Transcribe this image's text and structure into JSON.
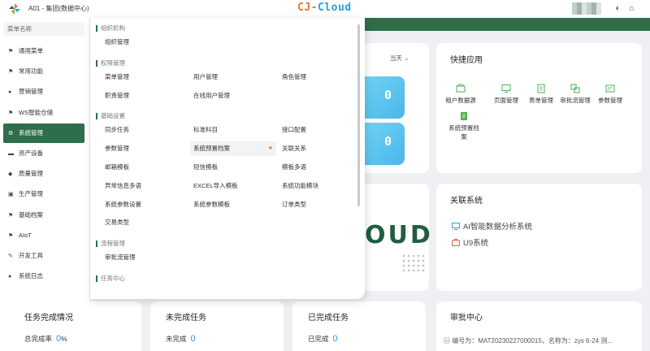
{
  "header": {
    "org": "A01 - 集团(数据中心)",
    "brand_part1": "CJ-",
    "brand_part2": "Cloud"
  },
  "sidebar": {
    "search_placeholder": "菜单名称",
    "items": [
      {
        "label": "通用菜单",
        "icon": "flag-icon",
        "glyph": "⚑"
      },
      {
        "label": "常用功能",
        "icon": "flag-icon",
        "glyph": "⚑"
      },
      {
        "label": "营销管理",
        "icon": "user-icon",
        "glyph": "●"
      },
      {
        "label": "WS智能仓储",
        "icon": "flag-icon",
        "glyph": "⚑"
      },
      {
        "label": "系统管理",
        "icon": "gear-icon",
        "glyph": "⚙",
        "active": true
      },
      {
        "label": "资产设备",
        "icon": "car-icon",
        "glyph": "▬"
      },
      {
        "label": "质量管理",
        "icon": "shield-icon",
        "glyph": "◆"
      },
      {
        "label": "生产管理",
        "icon": "cart-icon",
        "glyph": "▣"
      },
      {
        "label": "基础档案",
        "icon": "flag-icon",
        "glyph": "⚑"
      },
      {
        "label": "AIoT",
        "icon": "flag-icon",
        "glyph": "⚑"
      },
      {
        "label": "开发工具",
        "icon": "wrench-icon",
        "glyph": "✎"
      },
      {
        "label": "系统日志",
        "icon": "info-icon",
        "glyph": "●"
      }
    ]
  },
  "menu_panel": {
    "sections": [
      {
        "title": "组织机构",
        "items": [
          "组织管理"
        ]
      },
      {
        "title": "权限管理",
        "items": [
          "菜单管理",
          "用户管理",
          "角色管理",
          "职责管理",
          "在线用户管理"
        ]
      },
      {
        "title": "基础设置",
        "items": [
          "同步任务",
          "标准科目",
          "接口配置",
          "参数管理",
          "系统预置档案",
          "关联关系",
          "邮箱模板",
          "短信模板",
          "模板多语",
          "异常信息多语",
          "EXCEL导入模板",
          "系统功能模块",
          "系统参数设置",
          "系统参数模板",
          "订单类型",
          "交易类型"
        ]
      },
      {
        "title": "流程管理",
        "items": [
          "审批流管理"
        ]
      },
      {
        "title": "任务中心",
        "items": []
      }
    ],
    "highlighted": "系统预置档案",
    "star": "★"
  },
  "overview": {
    "period": "当天",
    "counter1": "0",
    "counter2": "0",
    "banner_text": "OUD"
  },
  "quick_apps": {
    "title": "快捷应用",
    "items": [
      "租户数据源",
      "页面管理",
      "表单管理",
      "审批流管理",
      "参数管理",
      "系统预置档案"
    ]
  },
  "related_systems": {
    "title": "关联系统",
    "items": [
      "AI智能数据分析系统",
      "U9系统"
    ]
  },
  "stats": {
    "task_completion": {
      "title": "任务完成情况",
      "label": "总完成率",
      "value": "0",
      "suffix": "%"
    },
    "unfinished": {
      "title": "未完成任务",
      "label": "未完成",
      "value": "0"
    },
    "finished": {
      "title": "已完成任务",
      "label": "已完成",
      "value": "0"
    }
  },
  "approval": {
    "title": "审批中心",
    "first_item": "编号为：MAT20230227000015，名称为：zys 6-24 测..."
  },
  "colors": {
    "primary": "#2e6e4b",
    "accent_blue": "#2aa2d8",
    "accent_orange": "#e9762b",
    "icon_green": "#4caf50",
    "icon_red": "#e85a4f"
  }
}
